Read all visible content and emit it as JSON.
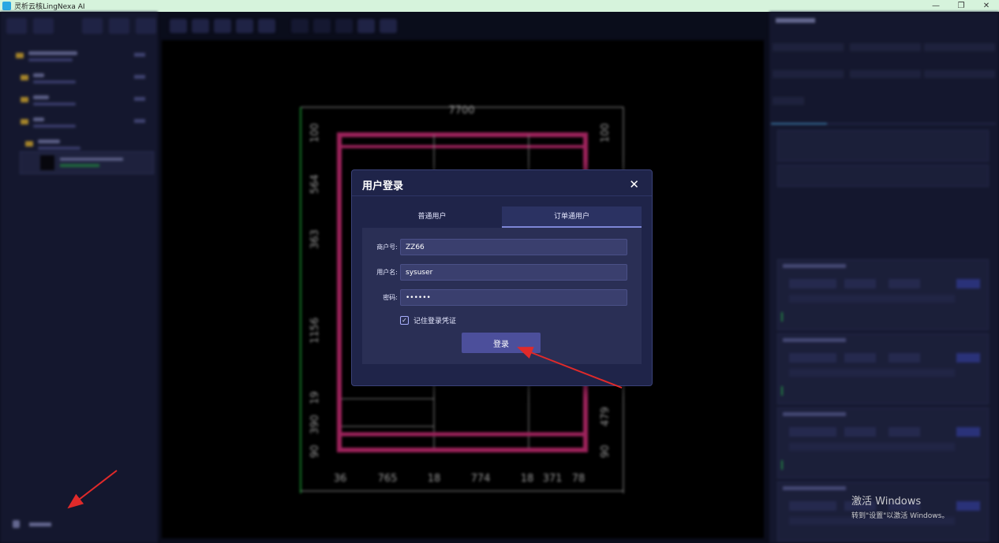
{
  "window": {
    "title": "灵析云核LingNexa AI",
    "controls": [
      "—",
      "❐",
      "✕"
    ]
  },
  "canvas_dimensions": {
    "top": "7700",
    "left": [
      "100",
      "564",
      "363",
      "1156",
      "19",
      "390",
      "90"
    ],
    "right": [
      "100",
      "564",
      "479",
      "90"
    ],
    "bottom": [
      "36",
      "765",
      "18",
      "774",
      "18",
      "371",
      "78"
    ]
  },
  "login_dialog": {
    "title": "用户登录",
    "close": "✕",
    "tabs": [
      {
        "label": "普通用户",
        "active": false
      },
      {
        "label": "订单通用户",
        "active": true
      }
    ],
    "fields": {
      "merchant_label": "商户号:",
      "merchant_value": "ZZ66",
      "username_label": "用户名:",
      "username_value": "sysuser",
      "password_label": "密码:",
      "password_value": "••••••"
    },
    "remember_label": "记住登录凭证",
    "remember_checked": true,
    "login_button": "登录"
  },
  "watermark": {
    "line1": "激活 Windows",
    "line2": "转到\"设置\"以激活 Windows。"
  },
  "colors": {
    "arrow": "#e02a2a",
    "accent": "#4c4f9b",
    "dialog_bg": "#1f2449"
  }
}
